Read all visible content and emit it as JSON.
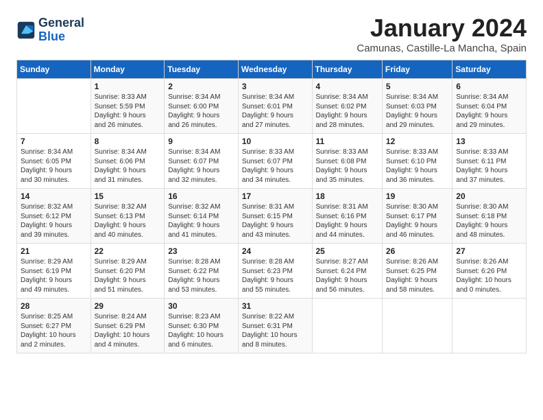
{
  "header": {
    "logo_line1": "General",
    "logo_line2": "Blue",
    "month": "January 2024",
    "location": "Camunas, Castille-La Mancha, Spain"
  },
  "days_of_week": [
    "Sunday",
    "Monday",
    "Tuesday",
    "Wednesday",
    "Thursday",
    "Friday",
    "Saturday"
  ],
  "weeks": [
    [
      {
        "day": "",
        "info": ""
      },
      {
        "day": "1",
        "info": "Sunrise: 8:33 AM\nSunset: 5:59 PM\nDaylight: 9 hours\nand 26 minutes."
      },
      {
        "day": "2",
        "info": "Sunrise: 8:34 AM\nSunset: 6:00 PM\nDaylight: 9 hours\nand 26 minutes."
      },
      {
        "day": "3",
        "info": "Sunrise: 8:34 AM\nSunset: 6:01 PM\nDaylight: 9 hours\nand 27 minutes."
      },
      {
        "day": "4",
        "info": "Sunrise: 8:34 AM\nSunset: 6:02 PM\nDaylight: 9 hours\nand 28 minutes."
      },
      {
        "day": "5",
        "info": "Sunrise: 8:34 AM\nSunset: 6:03 PM\nDaylight: 9 hours\nand 29 minutes."
      },
      {
        "day": "6",
        "info": "Sunrise: 8:34 AM\nSunset: 6:04 PM\nDaylight: 9 hours\nand 29 minutes."
      }
    ],
    [
      {
        "day": "7",
        "info": "Sunrise: 8:34 AM\nSunset: 6:05 PM\nDaylight: 9 hours\nand 30 minutes."
      },
      {
        "day": "8",
        "info": "Sunrise: 8:34 AM\nSunset: 6:06 PM\nDaylight: 9 hours\nand 31 minutes."
      },
      {
        "day": "9",
        "info": "Sunrise: 8:34 AM\nSunset: 6:07 PM\nDaylight: 9 hours\nand 32 minutes."
      },
      {
        "day": "10",
        "info": "Sunrise: 8:33 AM\nSunset: 6:07 PM\nDaylight: 9 hours\nand 34 minutes."
      },
      {
        "day": "11",
        "info": "Sunrise: 8:33 AM\nSunset: 6:08 PM\nDaylight: 9 hours\nand 35 minutes."
      },
      {
        "day": "12",
        "info": "Sunrise: 8:33 AM\nSunset: 6:10 PM\nDaylight: 9 hours\nand 36 minutes."
      },
      {
        "day": "13",
        "info": "Sunrise: 8:33 AM\nSunset: 6:11 PM\nDaylight: 9 hours\nand 37 minutes."
      }
    ],
    [
      {
        "day": "14",
        "info": "Sunrise: 8:32 AM\nSunset: 6:12 PM\nDaylight: 9 hours\nand 39 minutes."
      },
      {
        "day": "15",
        "info": "Sunrise: 8:32 AM\nSunset: 6:13 PM\nDaylight: 9 hours\nand 40 minutes."
      },
      {
        "day": "16",
        "info": "Sunrise: 8:32 AM\nSunset: 6:14 PM\nDaylight: 9 hours\nand 41 minutes."
      },
      {
        "day": "17",
        "info": "Sunrise: 8:31 AM\nSunset: 6:15 PM\nDaylight: 9 hours\nand 43 minutes."
      },
      {
        "day": "18",
        "info": "Sunrise: 8:31 AM\nSunset: 6:16 PM\nDaylight: 9 hours\nand 44 minutes."
      },
      {
        "day": "19",
        "info": "Sunrise: 8:30 AM\nSunset: 6:17 PM\nDaylight: 9 hours\nand 46 minutes."
      },
      {
        "day": "20",
        "info": "Sunrise: 8:30 AM\nSunset: 6:18 PM\nDaylight: 9 hours\nand 48 minutes."
      }
    ],
    [
      {
        "day": "21",
        "info": "Sunrise: 8:29 AM\nSunset: 6:19 PM\nDaylight: 9 hours\nand 49 minutes."
      },
      {
        "day": "22",
        "info": "Sunrise: 8:29 AM\nSunset: 6:20 PM\nDaylight: 9 hours\nand 51 minutes."
      },
      {
        "day": "23",
        "info": "Sunrise: 8:28 AM\nSunset: 6:22 PM\nDaylight: 9 hours\nand 53 minutes."
      },
      {
        "day": "24",
        "info": "Sunrise: 8:28 AM\nSunset: 6:23 PM\nDaylight: 9 hours\nand 55 minutes."
      },
      {
        "day": "25",
        "info": "Sunrise: 8:27 AM\nSunset: 6:24 PM\nDaylight: 9 hours\nand 56 minutes."
      },
      {
        "day": "26",
        "info": "Sunrise: 8:26 AM\nSunset: 6:25 PM\nDaylight: 9 hours\nand 58 minutes."
      },
      {
        "day": "27",
        "info": "Sunrise: 8:26 AM\nSunset: 6:26 PM\nDaylight: 10 hours\nand 0 minutes."
      }
    ],
    [
      {
        "day": "28",
        "info": "Sunrise: 8:25 AM\nSunset: 6:27 PM\nDaylight: 10 hours\nand 2 minutes."
      },
      {
        "day": "29",
        "info": "Sunrise: 8:24 AM\nSunset: 6:29 PM\nDaylight: 10 hours\nand 4 minutes."
      },
      {
        "day": "30",
        "info": "Sunrise: 8:23 AM\nSunset: 6:30 PM\nDaylight: 10 hours\nand 6 minutes."
      },
      {
        "day": "31",
        "info": "Sunrise: 8:22 AM\nSunset: 6:31 PM\nDaylight: 10 hours\nand 8 minutes."
      },
      {
        "day": "",
        "info": ""
      },
      {
        "day": "",
        "info": ""
      },
      {
        "day": "",
        "info": ""
      }
    ]
  ]
}
